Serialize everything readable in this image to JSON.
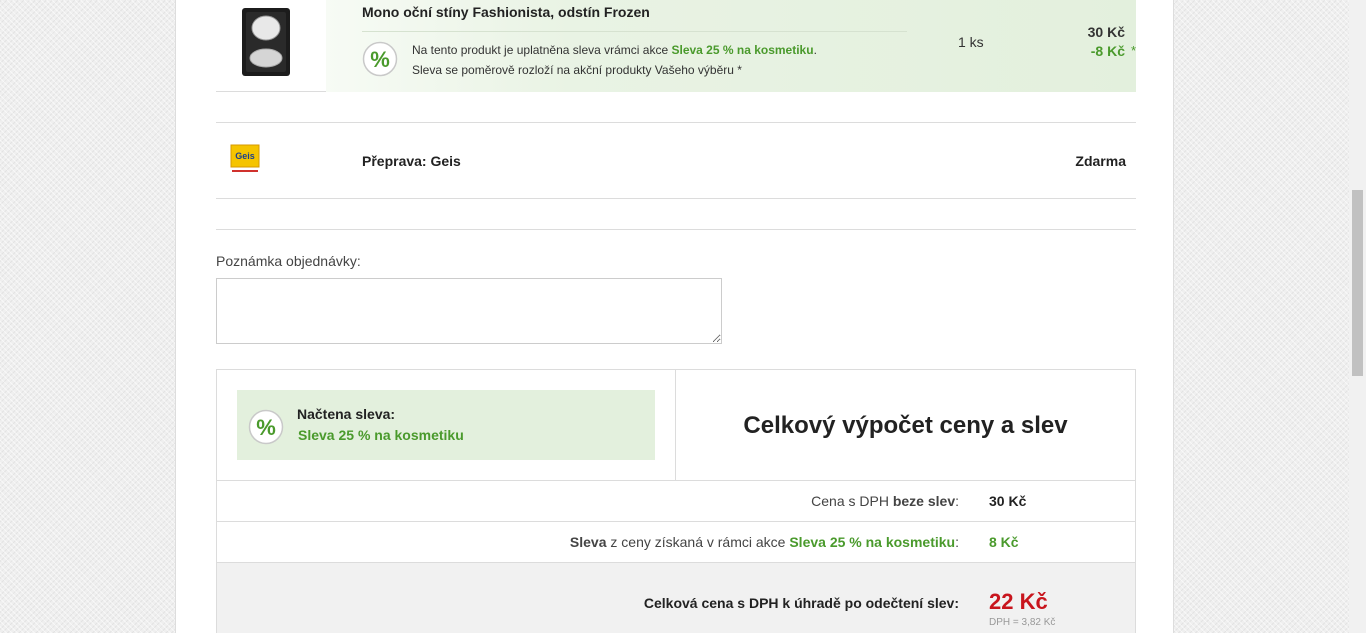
{
  "product": {
    "name": "Mono oční stíny Fashionista, odstín Frozen",
    "discount_text_before": "Na tento produkt je uplatněna sleva vrámci akce ",
    "discount_name": "Sleva 25 % na kosmetiku",
    "discount_text_after": ".",
    "discount_note": "Sleva se poměrově rozloží na akční produkty Vašeho výběru *",
    "quantity": "1 ks",
    "price": "30 Kč",
    "price_discount": "-8 Kč",
    "asterisk": "*"
  },
  "shipping": {
    "logo_text": "Geis",
    "label": "Přeprava: Geis",
    "price": "Zdarma"
  },
  "note": {
    "label": "Poznámka objednávky:",
    "value": ""
  },
  "summary": {
    "loaded_title": "Načtena sleva:",
    "loaded_value": "Sleva 25 % na kosmetiku",
    "heading": "Celkový výpočet ceny a slev",
    "row1_label_prefix": "Cena s DPH ",
    "row1_label_bold": "beze slev",
    "row1_label_suffix": ":",
    "row1_value": "30 Kč",
    "row2_label_bold": "Sleva",
    "row2_label_mid": " z ceny získaná v rámci akce ",
    "row2_label_green": "Sleva 25 % na kosmetiku",
    "row2_label_suffix": ":",
    "row2_value": "8 Kč",
    "total_label": "Celková cena s DPH k úhradě po odečtení slev:",
    "total_value": "22 Kč",
    "vat_value": "DPH = 3,82 Kč"
  },
  "colors": {
    "accent_green": "#4a9a2c",
    "total_red": "#c8151d",
    "green_bg": "#e3f0dd"
  }
}
